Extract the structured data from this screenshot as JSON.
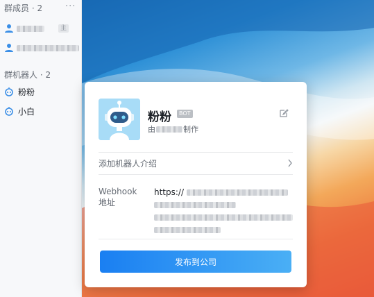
{
  "sidebar": {
    "members_title": "群成员 · 2",
    "more_label": "···",
    "bots_title": "群机器人 · 2",
    "member_tag": "主",
    "bots": [
      {
        "name": "粉粉"
      },
      {
        "name": "小白"
      }
    ]
  },
  "card": {
    "bot_name": "粉粉",
    "badge": "BOT",
    "creator_prefix": "由",
    "creator_suffix": "制作",
    "intro_label": "添加机器人介绍",
    "webhook_label": "Webhook 地址",
    "webhook_prefix": "https://",
    "publish_label": "发布到公司"
  },
  "colors": {
    "primary": "#1a7ff2",
    "bot_blue": "#3a8ee6"
  }
}
